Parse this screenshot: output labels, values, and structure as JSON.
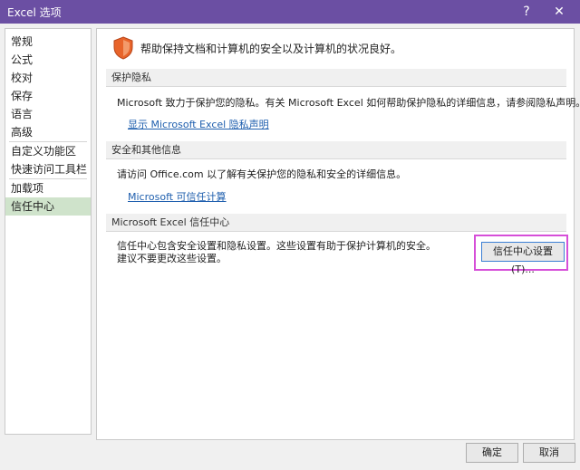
{
  "window": {
    "title": "Excel 选项",
    "help_button": "?",
    "close_button": "✕",
    "title_bar_color": "#6b4fa3"
  },
  "sidebar": {
    "items": [
      {
        "label": "常规"
      },
      {
        "label": "公式"
      },
      {
        "label": "校对"
      },
      {
        "label": "保存"
      },
      {
        "label": "语言"
      },
      {
        "label": "高级"
      },
      {
        "label": "自定义功能区"
      },
      {
        "label": "快速访问工具栏"
      },
      {
        "label": "加载项"
      },
      {
        "label": "信任中心"
      }
    ],
    "selected": "信任中心",
    "selected_color": "#cfe3cb"
  },
  "main": {
    "intro_icon": "shield-icon",
    "intro_text": "帮助保持文档和计算机的安全以及计算机的状况良好。",
    "privacy": {
      "header": "保护隐私",
      "text": "Microsoft 致力于保护您的隐私。有关 Microsoft Excel 如何帮助保护隐私的详细信息，请参阅隐私声明。",
      "link": "显示 Microsoft Excel 隐私声明"
    },
    "security": {
      "header": "安全和其他信息",
      "text": "请访问 Office.com 以了解有关保护您的隐私和安全的详细信息。",
      "link": "Microsoft 可信任计算"
    },
    "trust_center": {
      "header": "Microsoft Excel 信任中心",
      "text": "信任中心包含安全设置和隐私设置。这些设置有助于保护计算机的安全。建议不要更改这些设置。",
      "button": "信任中心设置(T)...",
      "highlight_color": "#d64fd8"
    }
  },
  "footer": {
    "ok": "确定",
    "cancel": "取消"
  },
  "colors": {
    "link": "#1f5fae",
    "shield": "#e8642a"
  }
}
